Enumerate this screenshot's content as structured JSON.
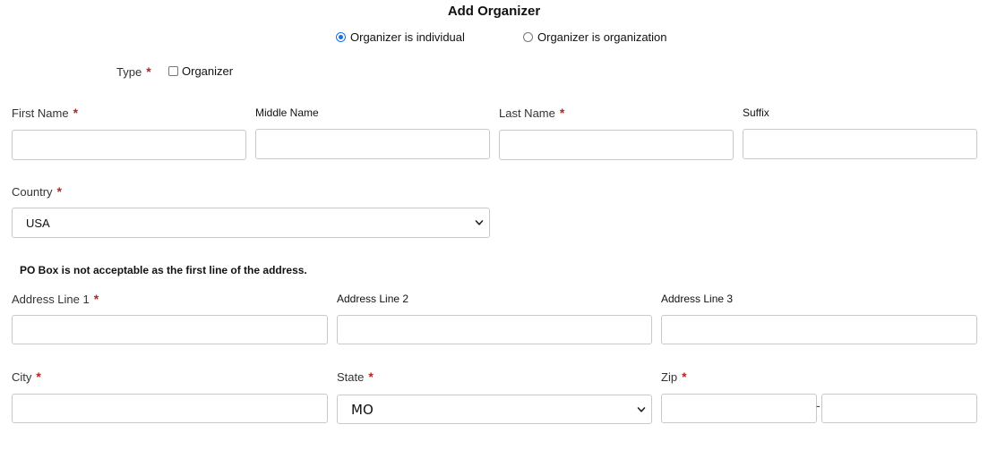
{
  "form": {
    "title": "Add Organizer",
    "organizer_kind": {
      "options": [
        {
          "label": "Organizer is individual",
          "checked": true
        },
        {
          "label": "Organizer is organization",
          "checked": false
        }
      ]
    },
    "type": {
      "label": "Type",
      "required_mark": "*",
      "checkbox_label": "Organizer",
      "checked": false
    },
    "name": {
      "first_label": "First Name",
      "middle_label": "Middle Name",
      "last_label": "Last Name",
      "suffix_label": "Suffix",
      "first_value": "",
      "middle_value": "",
      "last_value": "",
      "suffix_value": ""
    },
    "country": {
      "label": "Country",
      "selected": "USA"
    },
    "address_note": "PO Box is not acceptable as the first line of the address.",
    "address": {
      "line1_label": "Address Line 1",
      "line2_label": "Address Line 2",
      "line3_label": "Address Line 3",
      "line1_value": "",
      "line2_value": "",
      "line3_value": ""
    },
    "city": {
      "label": "City",
      "value": ""
    },
    "state": {
      "label": "State",
      "selected": "MO"
    },
    "zip": {
      "label": "Zip",
      "value": "",
      "ext_value": "",
      "separator": "-"
    },
    "required_mark": "*"
  },
  "colors": {
    "required": "#b5281c",
    "radio_accent": "#1a6fe0",
    "input_border": "#c9c9c9"
  },
  "icons": {
    "select_arrow": "chevron-down-icon"
  }
}
